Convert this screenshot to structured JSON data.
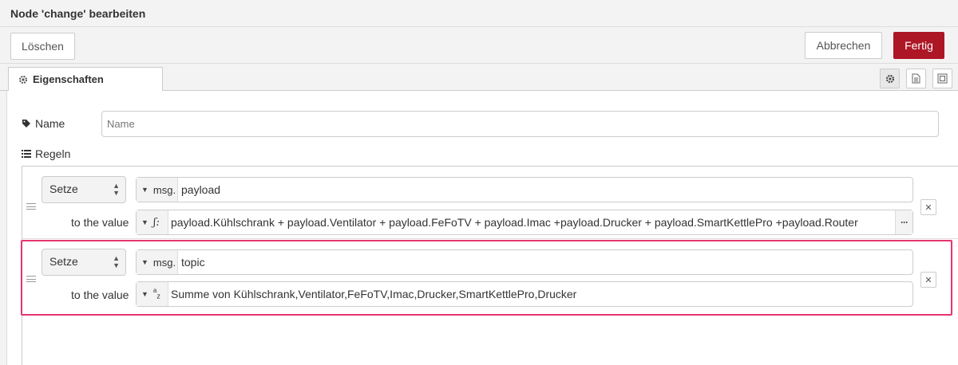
{
  "dialog": {
    "title": "Node 'change' bearbeiten",
    "delete_label": "Löschen",
    "cancel_label": "Abbrechen",
    "done_label": "Fertig"
  },
  "tabs": {
    "properties_label": "Eigenschaften"
  },
  "form": {
    "name_label": "Name",
    "name_placeholder": "Name",
    "rules_label": "Regeln"
  },
  "rules": [
    {
      "action": "Setze",
      "target_prefix": "msg.",
      "target_value": "payload",
      "to_label": "to the value",
      "value_type_icon": "jsonata-icon",
      "value": "payload.Kühlschrank + payload.Ventilator + payload.FeFoTV + payload.Imac +payload.Drucker + payload.SmartKettlePro +payload.Router"
    },
    {
      "action": "Setze",
      "target_prefix": "msg.",
      "target_value": "topic",
      "to_label": "to the value",
      "value_type_icon": "string-icon",
      "value": "Summe von Kühlschrank,Ventilator,FeFoTV,Imac,Drucker,SmartKettlePro,Drucker"
    }
  ],
  "colors": {
    "done_button": "#ad1625",
    "highlight": "#e6356e"
  }
}
